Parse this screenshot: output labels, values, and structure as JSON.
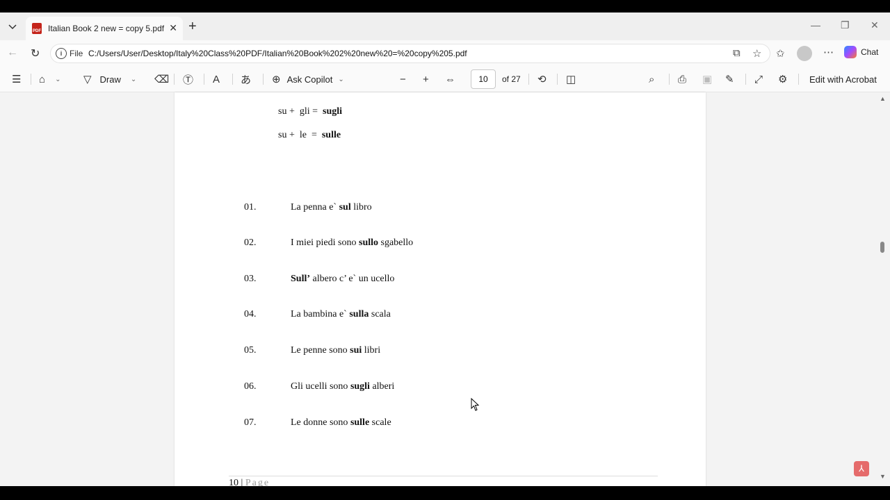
{
  "tab": {
    "title": "Italian Book 2 new = copy 5.pdf"
  },
  "address": {
    "scheme_label": "File",
    "url": "C:/Users/User/Desktop/Italy%20Class%20PDF/Italian%20Book%202%20new%20=%20copy%205.pdf"
  },
  "header": {
    "chat_label": "Chat"
  },
  "toolbar": {
    "draw_label": "Draw",
    "copilot_label": "Ask Copilot",
    "page_number": "10",
    "page_total": "of 27",
    "edit_label": "Edit with Acrobat"
  },
  "document": {
    "formulas": [
      {
        "left": "su +  gli =  ",
        "result": "sugli"
      },
      {
        "left": "su +  le  =  ",
        "result": "sulle"
      }
    ],
    "examples": [
      {
        "num": "01.",
        "before": "La penna e` ",
        "bold": "sul",
        "after": " libro"
      },
      {
        "num": "02.",
        "before": "I miei piedi sono ",
        "bold": "sullo",
        "after": " sgabello"
      },
      {
        "num": "03.",
        "before": "",
        "bold": "Sull’",
        "after": " albero c’ e` un ucello"
      },
      {
        "num": "04.",
        "before": "La bambina e` ",
        "bold": "sulla",
        "after": " scala"
      },
      {
        "num": "05.",
        "before": "Le penne sono ",
        "bold": "sui",
        "after": " libri"
      },
      {
        "num": "06.",
        "before": "Gli ucelli sono ",
        "bold": "sugli",
        "after": " alberi"
      },
      {
        "num": "07.",
        "before": "Le donne sono ",
        "bold": "sulle",
        "after": " scale"
      }
    ],
    "footer_number": "10",
    "footer_sep": " | ",
    "footer_page": "Page"
  },
  "icons": [
    "pdf-icon",
    "close-icon",
    "plus-icon",
    "back-icon",
    "refresh-icon",
    "info-icon",
    "copilot-icon",
    "star-icon",
    "favorites-icon",
    "more-icon",
    "contents-icon",
    "highlight-icon",
    "draw-icon",
    "eraser-icon",
    "textbox-icon",
    "read-aloud-icon",
    "translate-icon",
    "zoom-out-icon",
    "zoom-in-icon",
    "fit-icon",
    "rotate-icon",
    "page-view-icon",
    "search-icon",
    "print-icon",
    "save-icon",
    "save-as-icon",
    "fullscreen-icon",
    "settings-icon",
    "acrobat-icon"
  ]
}
